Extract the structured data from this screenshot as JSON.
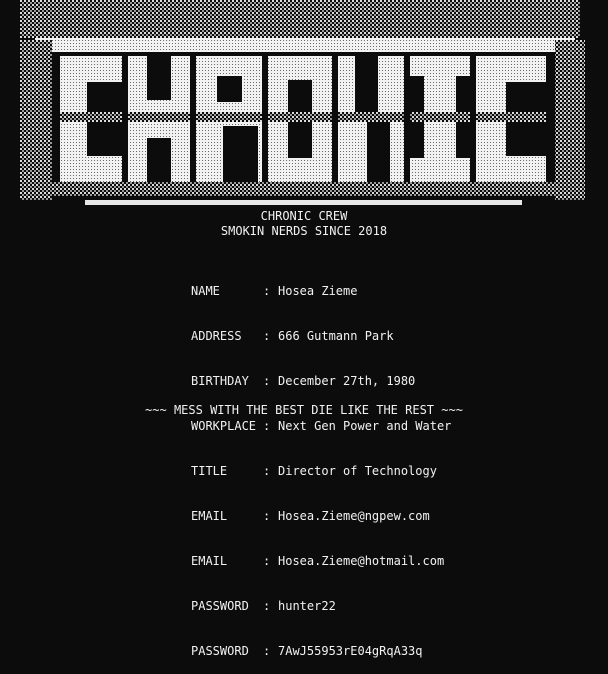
{
  "banner": {
    "art_text": "CHRONIC",
    "colors": {
      "fg": "#f2f2f2",
      "bg": "#0c0c0c"
    }
  },
  "header": {
    "line1": "CHRONIC CREW",
    "line2": "SMOKIN NERDS SINCE 2018"
  },
  "profile": {
    "separator": ":",
    "rows": [
      {
        "label": "NAME",
        "value": "Hosea Zieme"
      },
      {
        "label": "ADDRESS",
        "value": "666 Gutmann Park"
      },
      {
        "label": "BIRTHDAY",
        "value": "December 27th, 1980"
      },
      {
        "label": "WORKPLACE",
        "value": "Next Gen Power and Water"
      },
      {
        "label": "TITLE",
        "value": "Director of Technology"
      },
      {
        "label": "EMAIL",
        "value": "Hosea.Zieme@ngpew.com"
      },
      {
        "label": "EMAIL",
        "value": "Hosea.Zieme@hotmail.com"
      },
      {
        "label": "PASSWORD",
        "value": "hunter22"
      },
      {
        "label": "PASSWORD",
        "value": "7AwJ55953rE04gRqA33q"
      }
    ]
  },
  "footer": {
    "motto": "~~~ MESS WITH THE BEST DIE LIKE THE REST ~~~"
  }
}
